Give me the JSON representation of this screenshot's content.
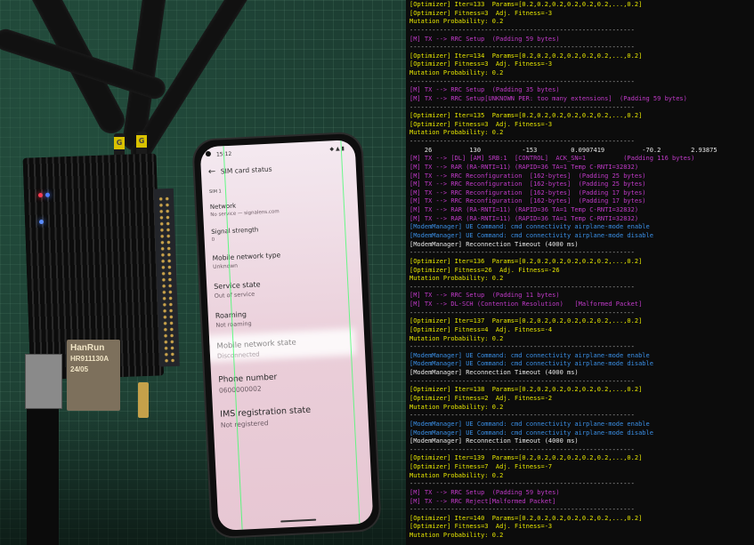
{
  "phone": {
    "status_time": "15:12",
    "status_icons": "◆ ▲ ▮",
    "back_icon": "←",
    "title": "SIM card status",
    "sim_label": "SIM 1",
    "rows": [
      {
        "label": "Network",
        "value": "No service — signalens.com"
      },
      {
        "label": "Signal strength",
        "value": "0"
      },
      {
        "label": "Mobile network type",
        "value": "Unknown"
      },
      {
        "label": "Service state",
        "value": "Out of service"
      },
      {
        "label": "Roaming",
        "value": "Not roaming"
      },
      {
        "label": "Mobile network state",
        "value": "Disconnected"
      },
      {
        "label": "Phone number",
        "value": "0600000002"
      },
      {
        "label": "IMS registration state",
        "value": "Not registered"
      }
    ]
  },
  "hardware": {
    "rj45_brand": "HanRun",
    "rj45_model": "HR911130A",
    "rj45_date": "24/05",
    "antenna_label": "G"
  },
  "terminal": {
    "lines": [
      {
        "text": "[Optimizer] Iter=133  Params=[0.2,0.2,0.2,0.2,0.2,0.2,...,0.2]",
        "style": "y"
      },
      {
        "text": "[Optimizer] Fitness=3  Adj. Fitness=-3",
        "style": "y"
      },
      {
        "text": "Mutation Probability: 0.2",
        "style": "y"
      },
      {
        "text": "------------------------------------------------------------",
        "style": "sep"
      },
      {
        "text": "[M] TX --> RRC Setup  (Padding 59 bytes)",
        "style": "m"
      },
      {
        "text": "------------------------------------------------------------",
        "style": "sep"
      },
      {
        "text": "[Optimizer] Iter=134  Params=[0.2,0.2,0.2,0.2,0.2,0.2,...,0.2]",
        "style": "y"
      },
      {
        "text": "[Optimizer] Fitness=3  Adj. Fitness=-3",
        "style": "y"
      },
      {
        "text": "Mutation Probability: 0.2",
        "style": "y"
      },
      {
        "text": "------------------------------------------------------------",
        "style": "sep"
      },
      {
        "text": "[M] TX --> RRC Setup  (Padding 35 bytes)",
        "style": "m"
      },
      {
        "text": "[M] TX --> RRC Setup[UNKNOWN PER: too many extensions]  (Padding 59 bytes)",
        "style": "m"
      },
      {
        "text": "------------------------------------------------------------",
        "style": "sep"
      },
      {
        "text": "[Optimizer] Iter=135  Params=[0.2,0.2,0.2,0.2,0.2,0.2,...,0.2]",
        "style": "y"
      },
      {
        "text": "[Optimizer] Fitness=3  Adj. Fitness=-3",
        "style": "y"
      },
      {
        "text": "Mutation Probability: 0.2",
        "style": "y"
      },
      {
        "text": "------------------------------------------------------------",
        "style": "sep"
      },
      {
        "text": "    26          130           -153         0.0907419          -70.2        2.93875",
        "style": "w"
      },
      {
        "text": "[M] TX --> [DL] [AM] SRB:1  [CONTROL]  ACK_SN=1          (Padding 116 bytes)",
        "style": "m"
      },
      {
        "text": "[M] TX --> RAR (RA-RNTI=11) (RAPID=36 TA=1 Temp C-RNTI=32832)",
        "style": "m"
      },
      {
        "text": "[M] TX --> RRC Reconfiguration  [162-bytes]  (Padding 25 bytes)",
        "style": "m"
      },
      {
        "text": "[M] TX --> RRC Reconfiguration  [162-bytes]  (Padding 25 bytes)",
        "style": "m"
      },
      {
        "text": "[M] TX --> RRC Reconfiguration  [162-bytes]  (Padding 17 bytes)",
        "style": "m"
      },
      {
        "text": "[M] TX --> RRC Reconfiguration  [162-bytes]  (Padding 17 bytes)",
        "style": "m"
      },
      {
        "text": "[M] TX --> RAR (RA-RNTI=11) (RAPID=36 TA=1 Temp C-RNTI=32832)",
        "style": "m"
      },
      {
        "text": "[M] TX --> RAR (RA-RNTI=11) (RAPID=36 TA=1 Temp C-RNTI=32832)",
        "style": "m"
      },
      {
        "text": "[ModemManager] UE Command: cmd connectivity airplane-mode enable",
        "style": "b"
      },
      {
        "text": "[ModemManager] UE Command: cmd connectivity airplane-mode disable",
        "style": "b"
      },
      {
        "text": "[ModemManager] Reconnection Timeout (4000 ms)",
        "style": "w"
      },
      {
        "text": "------------------------------------------------------------",
        "style": "sep"
      },
      {
        "text": "[Optimizer] Iter=136  Params=[0.2,0.2,0.2,0.2,0.2,0.2,...,0.2]",
        "style": "y"
      },
      {
        "text": "[Optimizer] Fitness=26  Adj. Fitness=-26",
        "style": "y"
      },
      {
        "text": "Mutation Probability: 0.2",
        "style": "y"
      },
      {
        "text": "------------------------------------------------------------",
        "style": "sep"
      },
      {
        "text": "[M] TX --> RRC Setup  (Padding 11 bytes)",
        "style": "m"
      },
      {
        "text": "[M] TX --> DL-SCH (Contention Resolution)   [Malformed Packet]",
        "style": "m"
      },
      {
        "text": "------------------------------------------------------------",
        "style": "sep"
      },
      {
        "text": "[Optimizer] Iter=137  Params=[0.2,0.2,0.2,0.2,0.2,0.2,...,0.2]",
        "style": "y"
      },
      {
        "text": "[Optimizer] Fitness=4  Adj. Fitness=-4",
        "style": "y"
      },
      {
        "text": "Mutation Probability: 0.2",
        "style": "y"
      },
      {
        "text": "------------------------------------------------------------",
        "style": "sep"
      },
      {
        "text": "[ModemManager] UE Command: cmd connectivity airplane-mode enable",
        "style": "b"
      },
      {
        "text": "[ModemManager] UE Command: cmd connectivity airplane-mode disable",
        "style": "b"
      },
      {
        "text": "[ModemManager] Reconnection Timeout (4000 ms)",
        "style": "w"
      },
      {
        "text": "------------------------------------------------------------",
        "style": "sep"
      },
      {
        "text": "[Optimizer] Iter=138  Params=[0.2,0.2,0.2,0.2,0.2,0.2,...,0.2]",
        "style": "y"
      },
      {
        "text": "[Optimizer] Fitness=2  Adj. Fitness=-2",
        "style": "y"
      },
      {
        "text": "Mutation Probability: 0.2",
        "style": "y"
      },
      {
        "text": "------------------------------------------------------------",
        "style": "sep"
      },
      {
        "text": "[ModemManager] UE Command: cmd connectivity airplane-mode enable",
        "style": "b"
      },
      {
        "text": "[ModemManager] UE Command: cmd connectivity airplane-mode disable",
        "style": "b"
      },
      {
        "text": "[ModemManager] Reconnection Timeout (4000 ms)",
        "style": "w"
      },
      {
        "text": "------------------------------------------------------------",
        "style": "sep"
      },
      {
        "text": "[Optimizer] Iter=139  Params=[0.2,0.2,0.2,0.2,0.2,0.2,...,0.2]",
        "style": "y"
      },
      {
        "text": "[Optimizer] Fitness=7  Adj. Fitness=-7",
        "style": "y"
      },
      {
        "text": "Mutation Probability: 0.2",
        "style": "y"
      },
      {
        "text": "------------------------------------------------------------",
        "style": "sep"
      },
      {
        "text": "[M] TX --> RRC Setup  (Padding 59 bytes)",
        "style": "m"
      },
      {
        "text": "[M] TX --> RRC Reject[Malformed Packet]",
        "style": "m"
      },
      {
        "text": "------------------------------------------------------------",
        "style": "sep"
      },
      {
        "text": "[Optimizer] Iter=140  Params=[0.2,0.2,0.2,0.2,0.2,0.2,...,0.2]",
        "style": "y"
      },
      {
        "text": "[Optimizer] Fitness=3  Adj. Fitness=-3",
        "style": "y"
      },
      {
        "text": "Mutation Probability: 0.2",
        "style": "y"
      }
    ]
  }
}
